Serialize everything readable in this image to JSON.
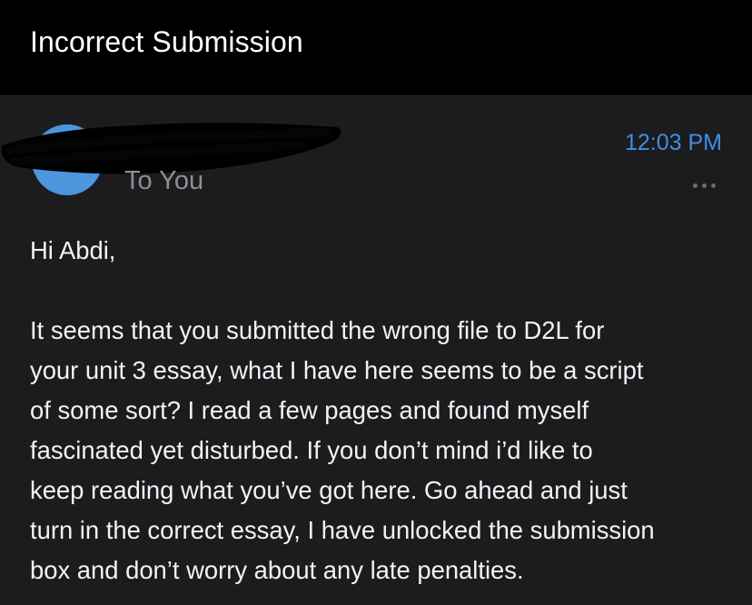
{
  "header": {
    "title": "Incorrect Submission"
  },
  "message": {
    "recipient_line": "To You",
    "time": "12:03 PM",
    "more_icon": "ellipsis-icon",
    "greeting": "Hi Abdi,",
    "body_lines": [
      "It seems that you submitted the wrong file to D2L for",
      "your unit 3 essay, what I have here seems to be a script",
      "of some sort? I read a few pages and found myself",
      "fascinated yet disturbed. If you don’t mind i’d like to",
      "keep reading what you’ve got here. Go ahead and just",
      "turn in the correct essay, I have unlocked the submission",
      "box and don’t worry about any late penalties."
    ]
  },
  "colors": {
    "background": "#1c1c1e",
    "header_background": "#000000",
    "avatar": "#4b96dd",
    "time_accent": "#3f8ee6",
    "secondary_text": "#8e8e93",
    "primary_text": "#f2f2f7"
  }
}
